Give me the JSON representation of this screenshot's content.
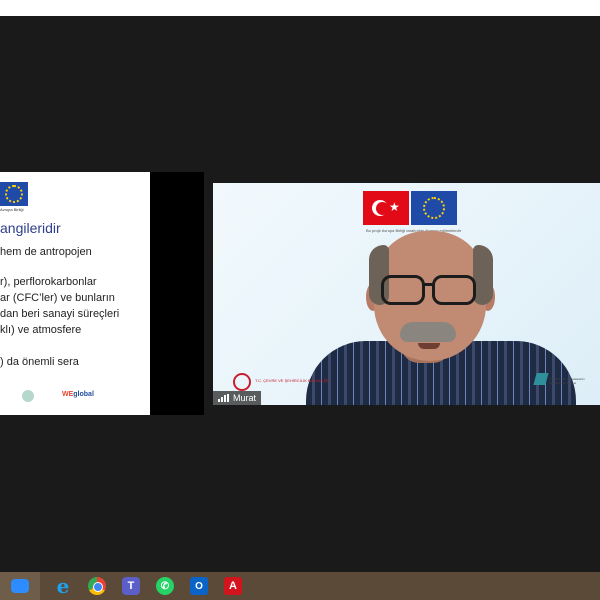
{
  "slide": {
    "eu_caption": "Avrupa Birliği",
    "title": "angileridir",
    "lines": [
      "hem de antropojen",
      "r), perflorokarbonlar",
      "ar (CFC’ler) ve bunların",
      "dan beri sanayi süreçleri",
      "klı) ve atmosfere",
      ") da önemli sera"
    ],
    "footer_logo_text_we": "WE",
    "footer_logo_text": "global"
  },
  "video": {
    "participant_name": "Murat",
    "project_caption": "Bu proje Avrupa Birliği tarafından finanse edilmektedir",
    "ministry_text": "T.C. ÇEVRE VE ŞEHİRCİLİK BAKANLIĞI",
    "right_logo_text": "Ulusal Uyum Kapasitesinin Geliştirilmesi Projesi"
  },
  "taskbar": {
    "apps": [
      "zoom",
      "internet-explorer",
      "chrome",
      "teams",
      "whatsapp",
      "outlook",
      "acrobat"
    ],
    "teams_label": "T",
    "whatsapp_label": "✆",
    "outlook_label": "O",
    "acrobat_label": "A",
    "ie_label": "e"
  },
  "colors": {
    "taskbar": "#5a4a37",
    "slide_title": "#2d3e8c",
    "tr_flag": "#e30a17",
    "eu_flag": "#1f4aa8"
  }
}
